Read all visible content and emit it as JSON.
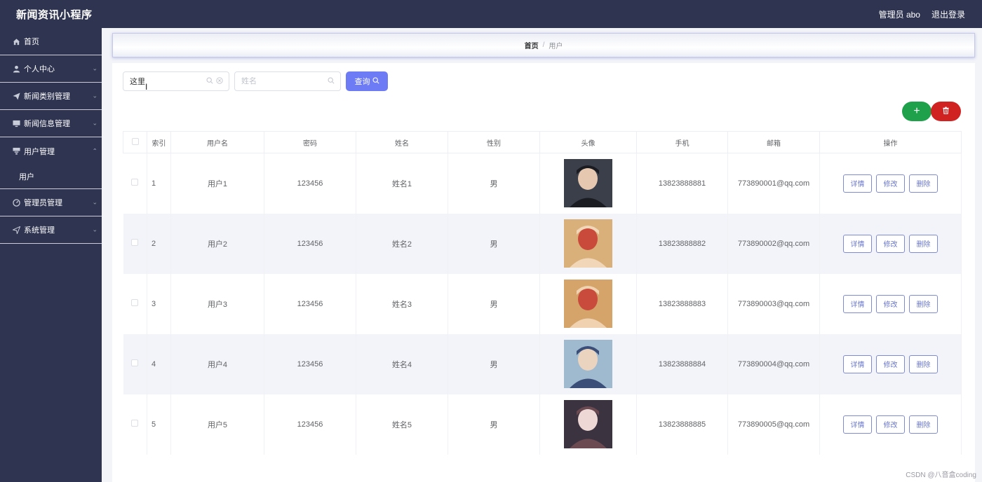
{
  "header": {
    "title": "新闻资讯小程序",
    "admin_label": "管理员 abo",
    "logout_label": "退出登录"
  },
  "sidebar": {
    "items": [
      {
        "label": "首页",
        "icon": "home-icon"
      },
      {
        "label": "个人中心",
        "icon": "user-icon"
      },
      {
        "label": "新闻类别管理",
        "icon": "send-icon"
      },
      {
        "label": "新闻信息管理",
        "icon": "monitor-icon"
      },
      {
        "label": "用户管理",
        "icon": "list-icon",
        "expanded": true,
        "sub": [
          {
            "label": "用户"
          }
        ]
      },
      {
        "label": "管理员管理",
        "icon": "gauge-icon"
      },
      {
        "label": "系统管理",
        "icon": "send-icon"
      }
    ]
  },
  "breadcrumb": {
    "home": "首页",
    "separator": "/",
    "current": "用户"
  },
  "search": {
    "field1_value": "这里",
    "field2_placeholder": "姓名",
    "query_label": "查询"
  },
  "actions": {
    "add_label": "+"
  },
  "table": {
    "columns": [
      "索引",
      "用户名",
      "密码",
      "姓名",
      "性别",
      "头像",
      "手机",
      "邮箱",
      "操作"
    ],
    "row_actions": {
      "detail": "详情",
      "edit": "修改",
      "delete": "删除"
    },
    "rows": [
      {
        "index": "1",
        "username": "用户1",
        "password": "123456",
        "name": "姓名1",
        "gender": "男",
        "phone": "13823888881",
        "email": "773890001@qq.com"
      },
      {
        "index": "2",
        "username": "用户2",
        "password": "123456",
        "name": "姓名2",
        "gender": "男",
        "phone": "13823888882",
        "email": "773890002@qq.com"
      },
      {
        "index": "3",
        "username": "用户3",
        "password": "123456",
        "name": "姓名3",
        "gender": "男",
        "phone": "13823888883",
        "email": "773890003@qq.com"
      },
      {
        "index": "4",
        "username": "用户4",
        "password": "123456",
        "name": "姓名4",
        "gender": "男",
        "phone": "13823888884",
        "email": "773890004@qq.com"
      },
      {
        "index": "5",
        "username": "用户5",
        "password": "123456",
        "name": "姓名5",
        "gender": "男",
        "phone": "13823888885",
        "email": "773890005@qq.com"
      }
    ]
  },
  "watermark": "CSDN @八音盒coding",
  "colors": {
    "sidebar_bg": "#2f3450",
    "primary": "#6d7cf5",
    "add": "#1fa14b",
    "danger": "#d12222"
  }
}
